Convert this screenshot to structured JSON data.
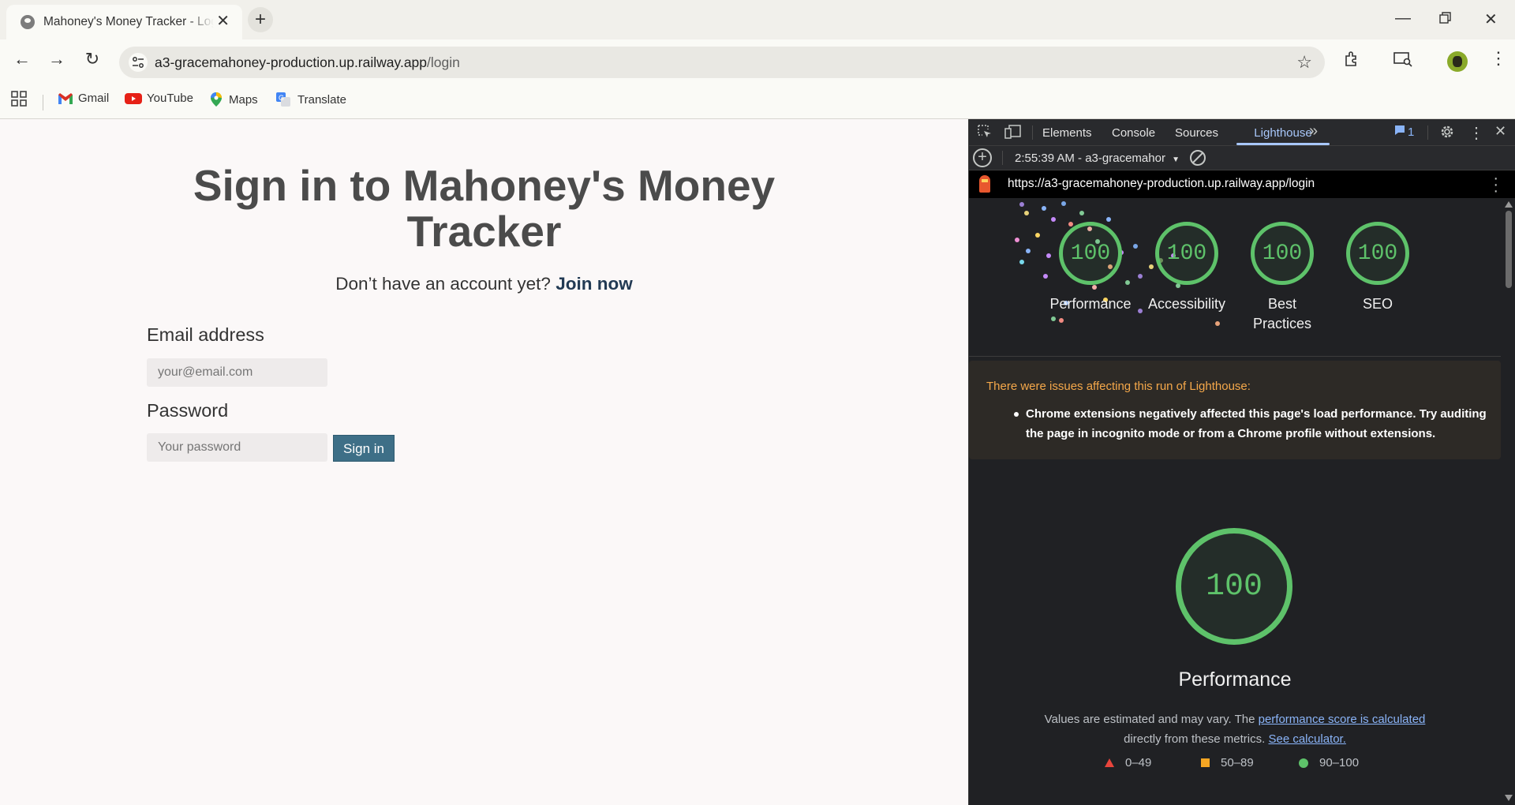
{
  "browser": {
    "tab_title": "Mahoney's Money Tracker - Login",
    "url_host": "a3-gracemahoney-production.up.railway.app",
    "url_path": "/login",
    "bookmarks": [
      "Gmail",
      "YouTube",
      "Maps",
      "Translate"
    ]
  },
  "page": {
    "title": "Sign in to Mahoney's Money Tracker",
    "signup_prompt": "Don’t have an account yet?",
    "signup_link": "Join now",
    "email_label": "Email address",
    "email_placeholder": "your@email.com",
    "password_label": "Password",
    "password_placeholder": "Your password",
    "signin_button": "Sign in"
  },
  "devtools": {
    "tabs": [
      "Elements",
      "Console",
      "Sources",
      "Lighthouse"
    ],
    "active_tab": "Lighthouse",
    "issues_count": "1",
    "run_label": "2:55:39 AM - a3-gracemahor",
    "report_url": "https://a3-gracemahoney-production.up.railway.app/login",
    "scores": [
      {
        "label": "Performance",
        "value": "100"
      },
      {
        "label": "Accessibility",
        "value": "100"
      },
      {
        "label": "Best Practices",
        "value": "100"
      },
      {
        "label": "SEO",
        "value": "100"
      }
    ],
    "issues_title": "There were issues affecting this run of Lighthouse:",
    "issues_item": "Chrome extensions negatively affected this page's load performance. Try auditing the page in incognito mode or from a Chrome profile without extensions.",
    "performance_score": "100",
    "performance_title": "Performance",
    "perf_desc_1": "Values are estimated and may vary. The",
    "perf_desc_link1": "performance score is calculated",
    "perf_desc_2": "directly from these metrics.",
    "perf_desc_link2": "See calculator.",
    "legend": [
      {
        "range": "0–49",
        "color": "#e8453c"
      },
      {
        "range": "50–89",
        "color": "#f5a623"
      },
      {
        "range": "90–100",
        "color": "#5ec26a"
      }
    ]
  }
}
